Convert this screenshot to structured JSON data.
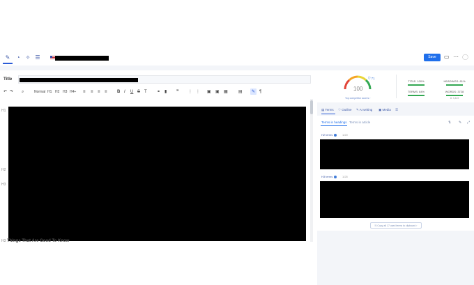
{
  "toolbar": {
    "tab_icons": [
      "pen-icon",
      "palette-icon",
      "magic-icon",
      "chat-icon"
    ],
    "save_label": "Save",
    "right_icons": [
      "folder-icon",
      "more-icon",
      "check-circle-icon"
    ]
  },
  "editor": {
    "title_label": "Title",
    "format": {
      "normal": "Normal",
      "h1": "H1",
      "h2": "H2",
      "h3": "H3",
      "h4": "H4+"
    },
    "gutter": {
      "h1": "H1",
      "h2a": "H2",
      "h3a": "H3",
      "h3b": "H3"
    },
    "things_heading": "Things That Are Good To Know"
  },
  "score": {
    "value": "100",
    "target": "71",
    "competitor_link": "Top competitor scores",
    "metrics": [
      {
        "label": "TITLE: 100%"
      },
      {
        "label": "HEADINGS: 81%"
      },
      {
        "label": "TERMS: 84%"
      },
      {
        "label": "WORDS: 3728"
      }
    ],
    "words_sub": "3,449"
  },
  "panel": {
    "tabs": [
      "Terms",
      "Outline",
      "AI writing",
      "Media"
    ],
    "subtabs": [
      "Terms in headings",
      "Terms in article"
    ],
    "h2_label": "H2 terms",
    "h3_label": "H3 terms",
    "count_h2": "1/20",
    "count_h3": "1/25",
    "copy_btn": "Copy all 17 used terms to clipboard"
  },
  "colors": {
    "accent": "#1f6feb",
    "good": "#33a852",
    "panel_bg": "#f3f5f9"
  }
}
